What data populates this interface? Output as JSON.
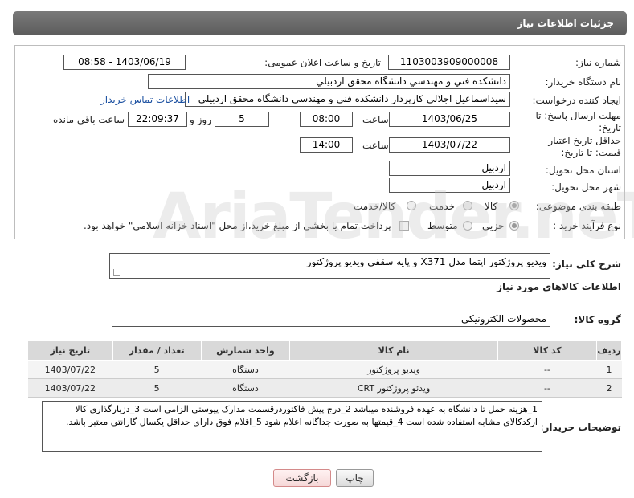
{
  "header": {
    "title": "جزئیات اطلاعات نیاز"
  },
  "form": {
    "need_number_label": "شماره نیاز:",
    "need_number": "1103003909000008",
    "announce_label": "تاریخ و ساعت اعلان عمومی:",
    "announce_value": "1403/06/19 - 08:58",
    "buyer_org_label": "نام دستگاه خریدار:",
    "buyer_org": "دانشکده فني و مهندسي دانشگاه محقق اردبيلي",
    "requester_label": "ایجاد کننده درخواست:",
    "requester": "سیداسماعیل اجلالی کارپرداز دانشکده فنی و مهندسی دانشگاه محقق اردبیلی",
    "contact_link": "اطلاعات تماس خریدار",
    "reply_deadline_label": "مهلت ارسال پاسخ: تا تاریخ:",
    "reply_date": "1403/06/25",
    "time_label": "ساعت",
    "reply_time": "08:00",
    "days_value": "5",
    "days_label": "روز و",
    "remaining_time": "22:09:37",
    "remaining_label": "ساعت باقی مانده",
    "validity_label": "حداقل تاریخ اعتبار قیمت: تا تاریخ:",
    "validity_date": "1403/07/22",
    "validity_time": "14:00",
    "province_label": "استان محل تحویل:",
    "province": "اردبیل",
    "city_label": "شهر محل تحویل:",
    "city": "اردبیل",
    "category_label": "طبقه بندی موضوعی:",
    "category_options": [
      "کالا",
      "خدمت",
      "کالا/خدمت"
    ],
    "process_label": "نوع فرآیند خرید :",
    "process_options": [
      "جزیی",
      "متوسط"
    ],
    "payment_note": "پرداخت تمام یا بخشی از مبلغ خرید،از محل \"اسناد خزانه اسلامی\" خواهد بود."
  },
  "summary": {
    "label": "شرح کلی نیاز:",
    "value": "ویدیو پروژکتور اپتما مدل X371 و پایه سقفی ویدیو پروژکتور"
  },
  "goods_section_title": "اطلاعات کالاهای مورد نیاز",
  "group": {
    "label": "گروه کالا:",
    "value": "محصولات الکترونیکی"
  },
  "table": {
    "headers": [
      "ردیف",
      "کد کالا",
      "نام کالا",
      "واحد شمارش",
      "تعداد / مقدار",
      "تاریخ نیاز"
    ],
    "rows": [
      [
        "1",
        "--",
        "ویدیو پروژکتور",
        "دستگاه",
        "5",
        "1403/07/22"
      ],
      [
        "2",
        "--",
        "ویدئو پروژکتور CRT",
        "دستگاه",
        "5",
        "1403/07/22"
      ]
    ]
  },
  "notes": {
    "label": "توضیحات خریدار:",
    "value": "1_هزینه حمل تا دانشگاه به عهده فروشنده میباشد 2_درج پیش فاکتوردرقسمت مدارک پیوستی الزامی است 3_دزبارگذاری کالا ازکدکالای مشابه استفاده شده است 4_قیمتها به صورت جداگانه اعلام شود 5_اقلام فوق دارای حداقل یکسال گارانتی معتبر باشد."
  },
  "buttons": {
    "print": "چاپ",
    "back": "بازگشت"
  },
  "watermark_text": "AriaTender.neT"
}
